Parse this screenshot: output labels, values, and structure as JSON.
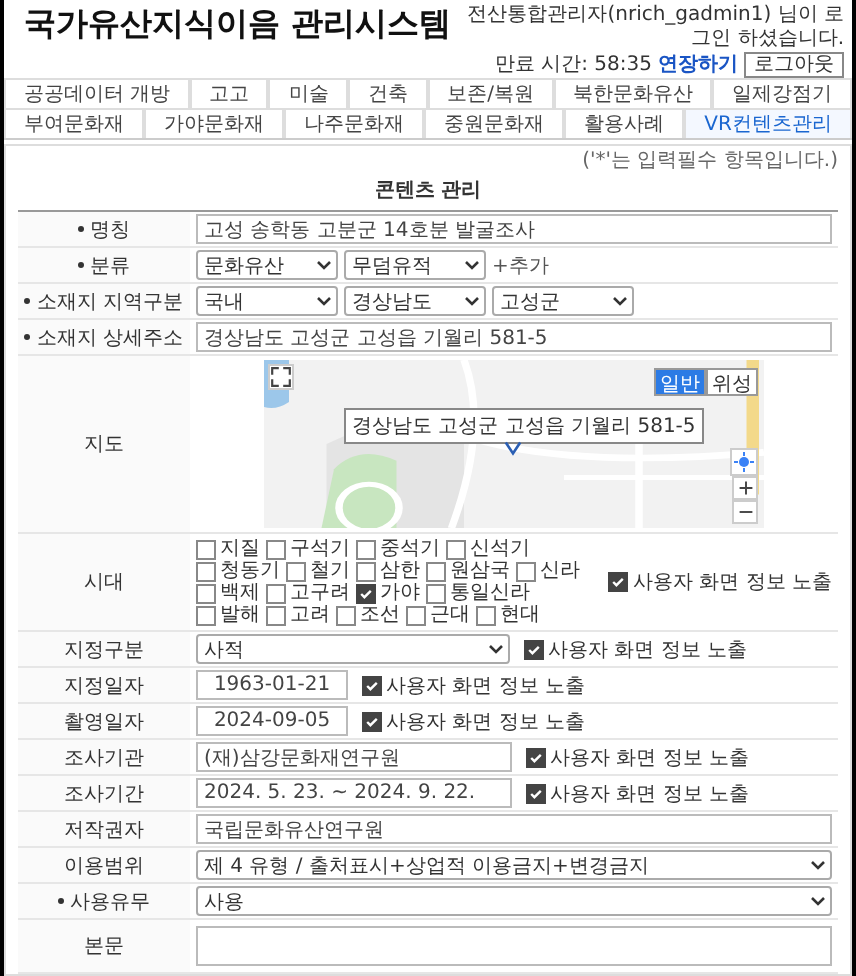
{
  "header": {
    "title": "국가유산지식이음 관리시스템",
    "user_notice": "전산통합관리자(nrich_gadmin1) 님이 로그인 하셨습니다.",
    "expiry": "만료 시간: 58:35",
    "extend_link": "연장하기",
    "logout_button": "로그아웃"
  },
  "tab_rows": [
    {
      "tabs": [
        {
          "label": "공공데이터 개방",
          "selected": false
        },
        {
          "label": "고고",
          "selected": false
        },
        {
          "label": "미술",
          "selected": false
        },
        {
          "label": "건축",
          "selected": false
        },
        {
          "label": "보존/복원",
          "selected": false
        },
        {
          "label": "북한문화유산",
          "selected": false
        },
        {
          "label": "일제강점기",
          "selected": false
        }
      ]
    },
    {
      "tabs": [
        {
          "label": "부여문화재",
          "selected": false
        },
        {
          "label": "가야문화재",
          "selected": false
        },
        {
          "label": "나주문화재",
          "selected": false
        },
        {
          "label": "중원문화재",
          "selected": false
        },
        {
          "label": "활용사례",
          "selected": false
        },
        {
          "label": "VR컨텐츠관리",
          "selected": true
        }
      ]
    }
  ],
  "required_note": "('*'는 입력필수 항목입니다.)",
  "form_title": "콘텐츠 관리",
  "rows": [
    {
      "kind": "text",
      "label": "명칭",
      "required": true,
      "value": "고성 송학동 고분군 14호분 발굴조사"
    },
    {
      "kind": "selects",
      "label": "분류",
      "required": true,
      "selects": [
        "문화유산",
        "무덤유적"
      ],
      "link": "+추가"
    },
    {
      "kind": "selects",
      "label": "소재지 지역구분",
      "required": true,
      "selects": [
        "국내",
        "경상남도",
        "고성군"
      ]
    },
    {
      "kind": "text",
      "label": "소재지 상세주소",
      "required": true,
      "value": "경상남도 고성군 고성읍 기월리 581-5"
    },
    {
      "kind": "map",
      "label": "지도",
      "required": false,
      "tooltip": "경상남도 고성군 고성읍 기월리 581-5",
      "map_types": [
        {
          "label": "일반",
          "selected": true
        },
        {
          "label": "위성",
          "selected": false
        }
      ]
    },
    {
      "kind": "periods",
      "label": "시대",
      "required": false,
      "options": [
        {
          "label": "지질",
          "checked": false
        },
        {
          "label": "구석기",
          "checked": false
        },
        {
          "label": "중석기",
          "checked": false
        },
        {
          "label": "신석기",
          "checked": false
        },
        {
          "label": "청동기",
          "checked": false
        },
        {
          "label": "철기",
          "checked": false
        },
        {
          "label": "삼한",
          "checked": false
        },
        {
          "label": "원삼국",
          "checked": false
        },
        {
          "label": "신라",
          "checked": false
        },
        {
          "label": "백제",
          "checked": false
        },
        {
          "label": "고구려",
          "checked": false
        },
        {
          "label": "가야",
          "checked": true
        },
        {
          "label": "통일신라",
          "checked": false
        },
        {
          "label": "발해",
          "checked": false
        },
        {
          "label": "고려",
          "checked": false
        },
        {
          "label": "조선",
          "checked": false
        },
        {
          "label": "근대",
          "checked": false
        },
        {
          "label": "현대",
          "checked": false
        }
      ],
      "expose": {
        "label": "사용자 화면 정보 노출",
        "checked": true
      }
    },
    {
      "kind": "select",
      "label": "지정구분",
      "required": false,
      "value": "사적",
      "expose": {
        "label": "사용자 화면 정보 노출",
        "checked": true
      }
    },
    {
      "kind": "date",
      "label": "지정일자",
      "required": false,
      "value": "1963-01-21",
      "expose": {
        "label": "사용자 화면 정보 노출",
        "checked": true
      }
    },
    {
      "kind": "date",
      "label": "촬영일자",
      "required": false,
      "value": "2024-09-05",
      "expose": {
        "label": "사용자 화면 정보 노출",
        "checked": true
      }
    },
    {
      "kind": "text",
      "label": "조사기관",
      "required": false,
      "value": "(재)삼강문화재연구원",
      "expose": {
        "label": "사용자 화면 정보 노출",
        "checked": true
      }
    },
    {
      "kind": "text",
      "label": "조사기간",
      "required": false,
      "value": "2024. 5. 23. ~ 2024. 9. 22.",
      "expose": {
        "label": "사용자 화면 정보 노출",
        "checked": true
      }
    },
    {
      "kind": "text",
      "label": "저작권자",
      "required": false,
      "value": "국립문화유산연구원"
    },
    {
      "kind": "select",
      "label": "이용범위",
      "required": false,
      "value": "제 4 유형 / 출처표시+상업적 이용금지+변경금지"
    },
    {
      "kind": "select",
      "label": "사용유무",
      "required": true,
      "value": "사용"
    },
    {
      "kind": "textarea",
      "label": "본문",
      "required": false
    }
  ]
}
